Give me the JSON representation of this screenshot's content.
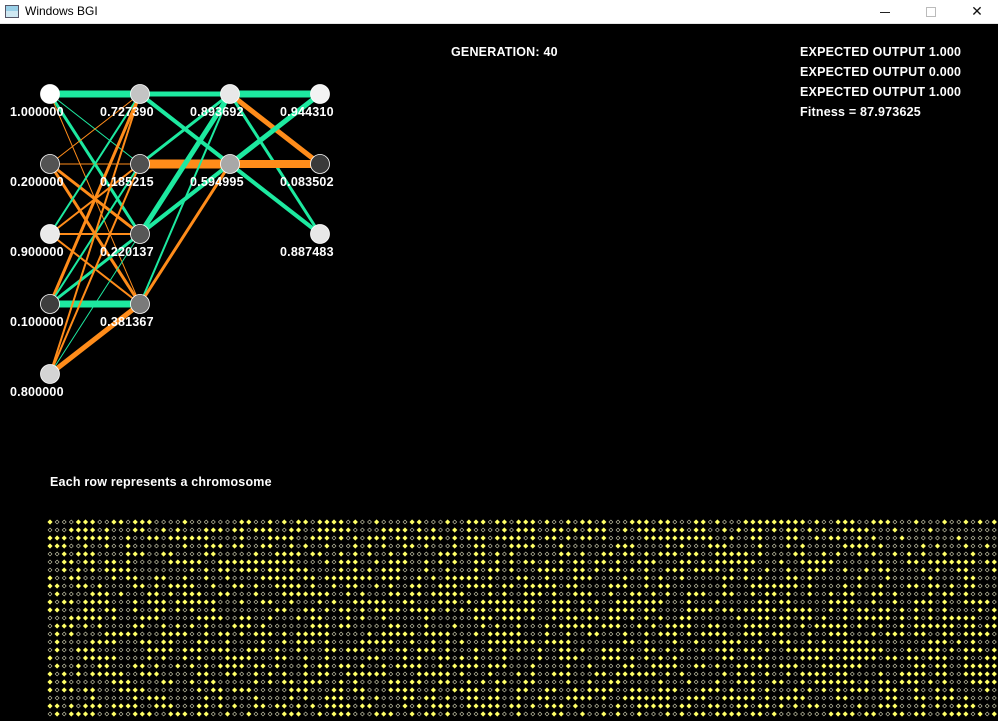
{
  "window": {
    "title": "Windows BGI",
    "minimize_icon": "minimize-icon",
    "maximize_icon": "maximize-icon",
    "close_glyph": "✕"
  },
  "generation_label": "GENERATION: 40",
  "expected_outputs": [
    "EXPECTED OUTPUT 1.000",
    "EXPECTED OUTPUT 0.000",
    "EXPECTED OUTPUT 1.000"
  ],
  "fitness_label": "Fitness = 87.973625",
  "chromosome_caption": "Each row represents a chromosome",
  "colors": {
    "background": "#000000",
    "positive_weight": "#1de9a0",
    "negative_weight": "#ff8c1a",
    "chromosome_dot": "#ffff66",
    "chromosome_faint": "#cfcfb0",
    "text": "#ffffff"
  },
  "network": {
    "layers": [
      {
        "neurons": [
          {
            "value": "1.000000",
            "level": 1.0
          },
          {
            "value": "0.200000",
            "level": 0.2
          },
          {
            "value": "0.900000",
            "level": 0.9
          },
          {
            "value": "0.100000",
            "level": 0.1
          },
          {
            "value": "0.800000",
            "level": 0.8
          }
        ]
      },
      {
        "neurons": [
          {
            "value": "0.727390",
            "level": 0.72739
          },
          {
            "value": "0.185215",
            "level": 0.185215
          },
          {
            "value": "0.220137",
            "level": 0.220137
          },
          {
            "value": "0.381367",
            "level": 0.381367
          }
        ]
      },
      {
        "neurons": [
          {
            "value": "0.893692",
            "level": 0.893692
          },
          {
            "value": "0.594995",
            "level": 0.594995
          }
        ]
      },
      {
        "neurons": [
          {
            "value": "0.944310",
            "level": 0.94431
          },
          {
            "value": "0.083502",
            "level": 0.083502
          },
          {
            "value": "0.887483",
            "level": 0.887483
          }
        ]
      }
    ],
    "connections": [
      {
        "from": [
          0,
          0
        ],
        "to": [
          1,
          0
        ],
        "sign": "pos",
        "width": 7
      },
      {
        "from": [
          0,
          0
        ],
        "to": [
          1,
          1
        ],
        "sign": "pos",
        "width": 1
      },
      {
        "from": [
          0,
          0
        ],
        "to": [
          1,
          2
        ],
        "sign": "pos",
        "width": 3
      },
      {
        "from": [
          0,
          0
        ],
        "to": [
          1,
          3
        ],
        "sign": "neg",
        "width": 1
      },
      {
        "from": [
          0,
          1
        ],
        "to": [
          1,
          0
        ],
        "sign": "neg",
        "width": 1
      },
      {
        "from": [
          0,
          1
        ],
        "to": [
          1,
          1
        ],
        "sign": "neg",
        "width": 1
      },
      {
        "from": [
          0,
          1
        ],
        "to": [
          1,
          2
        ],
        "sign": "neg",
        "width": 3
      },
      {
        "from": [
          0,
          1
        ],
        "to": [
          1,
          3
        ],
        "sign": "neg",
        "width": 3
      },
      {
        "from": [
          0,
          2
        ],
        "to": [
          1,
          0
        ],
        "sign": "pos",
        "width": 2
      },
      {
        "from": [
          0,
          2
        ],
        "to": [
          1,
          1
        ],
        "sign": "neg",
        "width": 2
      },
      {
        "from": [
          0,
          2
        ],
        "to": [
          1,
          2
        ],
        "sign": "neg",
        "width": 2
      },
      {
        "from": [
          0,
          2
        ],
        "to": [
          1,
          3
        ],
        "sign": "neg",
        "width": 2
      },
      {
        "from": [
          0,
          3
        ],
        "to": [
          1,
          0
        ],
        "sign": "neg",
        "width": 3
      },
      {
        "from": [
          0,
          3
        ],
        "to": [
          1,
          1
        ],
        "sign": "pos",
        "width": 2
      },
      {
        "from": [
          0,
          3
        ],
        "to": [
          1,
          2
        ],
        "sign": "pos",
        "width": 3
      },
      {
        "from": [
          0,
          3
        ],
        "to": [
          1,
          3
        ],
        "sign": "pos",
        "width": 7
      },
      {
        "from": [
          0,
          4
        ],
        "to": [
          1,
          0
        ],
        "sign": "neg",
        "width": 2
      },
      {
        "from": [
          0,
          4
        ],
        "to": [
          1,
          1
        ],
        "sign": "neg",
        "width": 2
      },
      {
        "from": [
          0,
          4
        ],
        "to": [
          1,
          2
        ],
        "sign": "pos",
        "width": 1
      },
      {
        "from": [
          0,
          4
        ],
        "to": [
          1,
          3
        ],
        "sign": "neg",
        "width": 5
      },
      {
        "from": [
          1,
          0
        ],
        "to": [
          2,
          0
        ],
        "sign": "pos",
        "width": 5
      },
      {
        "from": [
          1,
          0
        ],
        "to": [
          2,
          1
        ],
        "sign": "pos",
        "width": 4
      },
      {
        "from": [
          1,
          1
        ],
        "to": [
          2,
          0
        ],
        "sign": "pos",
        "width": 3
      },
      {
        "from": [
          1,
          1
        ],
        "to": [
          2,
          1
        ],
        "sign": "neg",
        "width": 9
      },
      {
        "from": [
          1,
          2
        ],
        "to": [
          2,
          0
        ],
        "sign": "pos",
        "width": 5
      },
      {
        "from": [
          1,
          2
        ],
        "to": [
          2,
          1
        ],
        "sign": "pos",
        "width": 4
      },
      {
        "from": [
          1,
          3
        ],
        "to": [
          2,
          0
        ],
        "sign": "pos",
        "width": 2
      },
      {
        "from": [
          1,
          3
        ],
        "to": [
          2,
          1
        ],
        "sign": "neg",
        "width": 3
      },
      {
        "from": [
          2,
          0
        ],
        "to": [
          3,
          0
        ],
        "sign": "pos",
        "width": 7
      },
      {
        "from": [
          2,
          0
        ],
        "to": [
          3,
          1
        ],
        "sign": "neg",
        "width": 5
      },
      {
        "from": [
          2,
          0
        ],
        "to": [
          3,
          2
        ],
        "sign": "pos",
        "width": 3
      },
      {
        "from": [
          2,
          1
        ],
        "to": [
          3,
          0
        ],
        "sign": "pos",
        "width": 5
      },
      {
        "from": [
          2,
          1
        ],
        "to": [
          3,
          1
        ],
        "sign": "neg",
        "width": 8
      },
      {
        "from": [
          2,
          1
        ],
        "to": [
          3,
          2
        ],
        "sign": "pos",
        "width": 4
      }
    ]
  },
  "chromosomes": {
    "rows": 25,
    "columns": 134
  }
}
